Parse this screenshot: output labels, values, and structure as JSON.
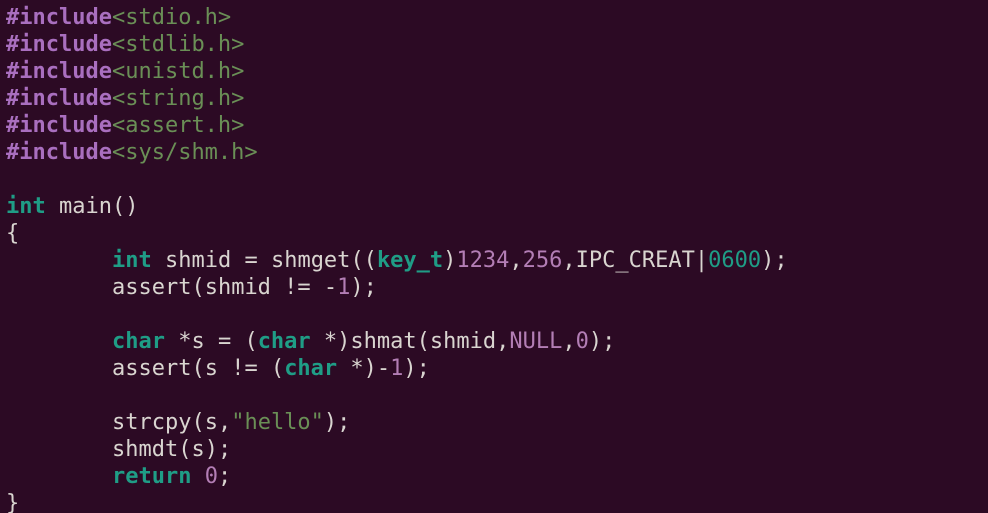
{
  "code": {
    "includes": [
      {
        "directive": "#include",
        "header": "<stdio.h>"
      },
      {
        "directive": "#include",
        "header": "<stdlib.h>"
      },
      {
        "directive": "#include",
        "header": "<unistd.h>"
      },
      {
        "directive": "#include",
        "header": "<string.h>"
      },
      {
        "directive": "#include",
        "header": "<assert.h>"
      },
      {
        "directive": "#include",
        "header": "<sys/shm.h>"
      }
    ],
    "func_ret_type": "int",
    "func_name": "main",
    "func_open_paren": "(",
    "func_close_paren": ")",
    "brace_open": "{",
    "brace_close": "}",
    "indent": "        ",
    "line_shmget": {
      "type": "int",
      "var": "shmid",
      "eq": " = ",
      "call": "shmget",
      "open": "((",
      "cast": "key_t",
      "close_cast": ")",
      "arg_key": "1234",
      "comma1": ",",
      "arg_size": "256",
      "comma2": ",",
      "flag": "IPC_CREAT",
      "or": "|",
      "mode": "0600",
      "close": ");"
    },
    "line_assert1": {
      "call": "assert",
      "open": "(",
      "var": "shmid",
      "ne": " != ",
      "minus": "-",
      "one": "1",
      "close": ");"
    },
    "line_shmat": {
      "type": "char",
      "star1": " *",
      "var": "s",
      "eq": " = (",
      "cast_type": "char",
      "cast_star": " *",
      "cast_close": ")",
      "call": "shmat",
      "open": "(",
      "arg1": "shmid",
      "comma1": ",",
      "arg2": "NULL",
      "comma2": ",",
      "arg3": "0",
      "close": ");"
    },
    "line_assert2": {
      "call": "assert",
      "open": "(",
      "var": "s",
      "ne": " != (",
      "cast_type": "char",
      "cast_star": " *",
      "cast_close": ")",
      "minus": "-",
      "one": "1",
      "close": ");"
    },
    "line_strcpy": {
      "call": "strcpy",
      "open": "(",
      "arg1": "s",
      "comma": ",",
      "str": "\"hello\"",
      "close": ");"
    },
    "line_shmdt": {
      "call": "shmdt",
      "open": "(",
      "arg": "s",
      "close": ");"
    },
    "line_return": {
      "kw": "return",
      "sp": " ",
      "val": "0",
      "semi": ";"
    }
  }
}
